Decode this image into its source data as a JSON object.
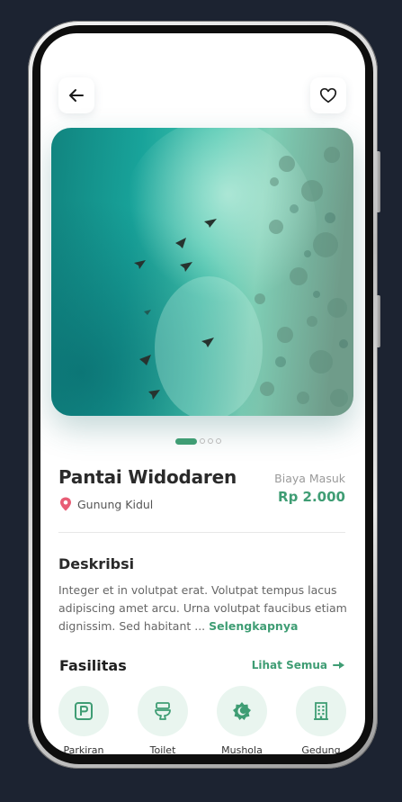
{
  "colors": {
    "accent": "#3f9d74",
    "accent_light": "#e9f5ef",
    "pin": "#e85d75"
  },
  "place": {
    "name": "Pantai Widodaren",
    "location": "Gunung Kidul",
    "fee_label": "Biaya Masuk",
    "fee_value": "Rp 2.000"
  },
  "gallery": {
    "image_count": 4,
    "active_index": 0
  },
  "description": {
    "title": "Deskribsi",
    "text": "Integer et in volutpat erat. Volutpat tempus lacus adipiscing amet arcu. Urna volutpat faucibus etiam dignissim. Sed habitant ... ",
    "more_label": "Selengkapnya"
  },
  "facilities": {
    "title": "Fasilitas",
    "see_all_label": "Lihat Semua",
    "items": [
      {
        "label": "Parkiran",
        "icon": "parking-icon"
      },
      {
        "label": "Toilet",
        "icon": "toilet-icon"
      },
      {
        "label": "Mushola",
        "icon": "mosque-icon"
      },
      {
        "label": "Gedung",
        "icon": "building-icon"
      }
    ]
  }
}
